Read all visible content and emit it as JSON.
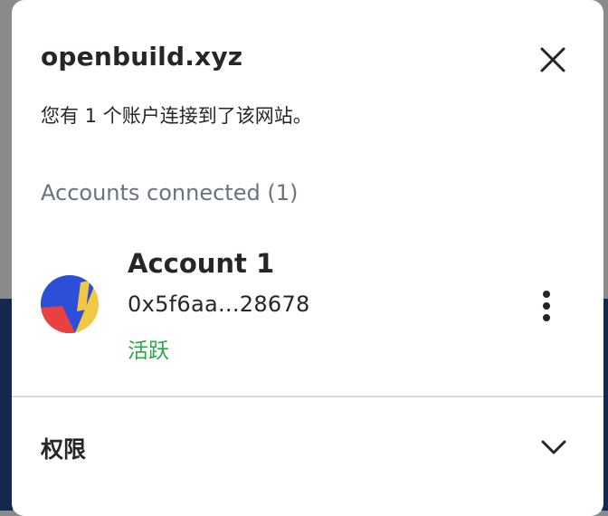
{
  "modal": {
    "site": "openbuild.xyz",
    "connection_summary": "您有 1 个账户连接到了该网站。",
    "section_label": "Accounts connected (1)",
    "close_icon": "close-icon"
  },
  "account": {
    "name": "Account 1",
    "address": "0x5f6aa...28678",
    "status": "活跃",
    "status_color": "#28a745",
    "avatar_icon": "jazzicon-avatar",
    "more_icon": "more-vertical-icon"
  },
  "permissions": {
    "label": "权限",
    "chevron_icon": "chevron-down-icon"
  },
  "colors": {
    "text_primary": "#24272a",
    "text_muted": "#6a737d",
    "divider": "#d6d9dc",
    "background_dark": "#13284e"
  }
}
